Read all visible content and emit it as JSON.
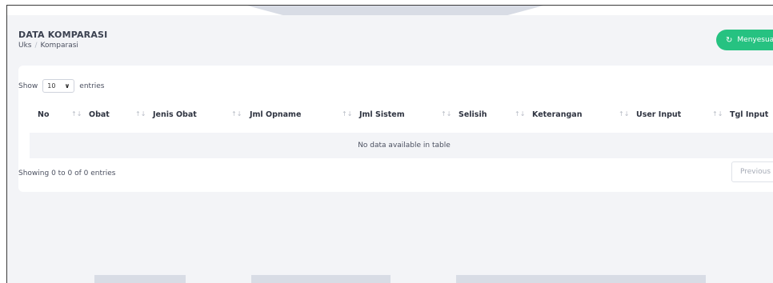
{
  "header": {
    "title": "DATA KOMPARASI",
    "breadcrumb": [
      "Uks",
      "Komparasi"
    ],
    "breadcrumb_separator": "/"
  },
  "actions": {
    "sync_label": "Menyesuaikan",
    "sync_icon": "refresh-icon"
  },
  "table_controls": {
    "show_label": "Show",
    "page_size": "10",
    "entries_label": "entries"
  },
  "table": {
    "columns": [
      "No",
      "Obat",
      "Jenis Obat",
      "Jml Opname",
      "Jml Sistem",
      "Selisih",
      "Keterangan",
      "User Input",
      "Tgl Input"
    ],
    "empty_message": "No data available in table"
  },
  "footer": {
    "info": "Showing 0 to 0 of 0 entries",
    "previous_label": "Previous"
  },
  "colors": {
    "accent": "#26c281",
    "background": "#f3f4f7",
    "card": "#ffffff"
  }
}
